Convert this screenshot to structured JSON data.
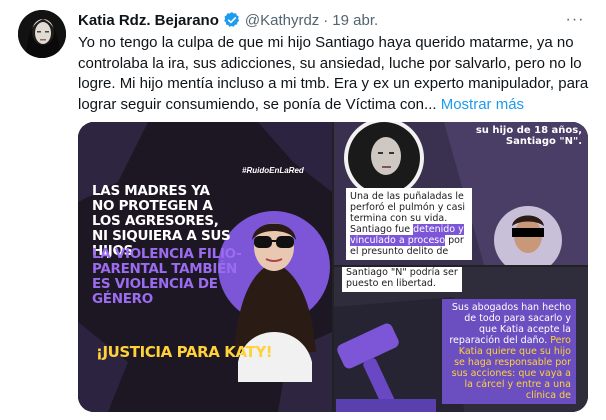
{
  "tweet": {
    "author_name": "Katia Rdz. Bejarano",
    "handle": "@Kathyrdz",
    "separator": "·",
    "date": "19 abr.",
    "more_label": "···",
    "text": "Yo no tengo la culpa de que mi hijo Santiago haya querido matarme, ya no controlaba la ira, sus adicciones, su ansiedad, luche por salvarlo, pero no lo logre. Mi hijo mentía incluso a mi tmb. Era y ex un experto manipulador, para lograr seguir consumiendo, se ponía de Víctima con...",
    "show_more": "Mostrar más"
  },
  "media": {
    "left": {
      "tag": "#RuidoEnLaRed",
      "headline_white": "LAS MADRES YA NO PROTEGEN A LOS AGRESORES, NI SIQUIERA A SUS HIJOS",
      "headline_purple": "LA VIOLENCIA FILIO-PARENTAL TAMBIÉN ES VIOLENCIA DE GÉNERO",
      "cta": "¡JUSTICIA PARA KATY!"
    },
    "right_top": {
      "caption": "su hijo de 18 años, Santiago \"N\".",
      "body_start": "Una de las puñaladas le perforó el pulmón y casi termina con su vida. Santiago fue ",
      "body_highlight": "detenido y vinculado a proceso",
      "body_end": " por el presunto delito de"
    },
    "right_bottom": {
      "top_text": "Santiago \"N\" podría ser puesto en libertad.",
      "body_start": "Sus abogados han hecho de todo para sacarlo y que Katia acepte la reparación del daño. ",
      "body_highlight": "Pero Katia quiere que su hijo se haga responsable por sus acciones: que vaya a la cárcel y entre a una clínica de"
    },
    "colors": {
      "purple": "#7c56d6",
      "yellow": "#ffd23a",
      "link": "#1d9bf0",
      "verified": "#1d9bf0"
    }
  }
}
